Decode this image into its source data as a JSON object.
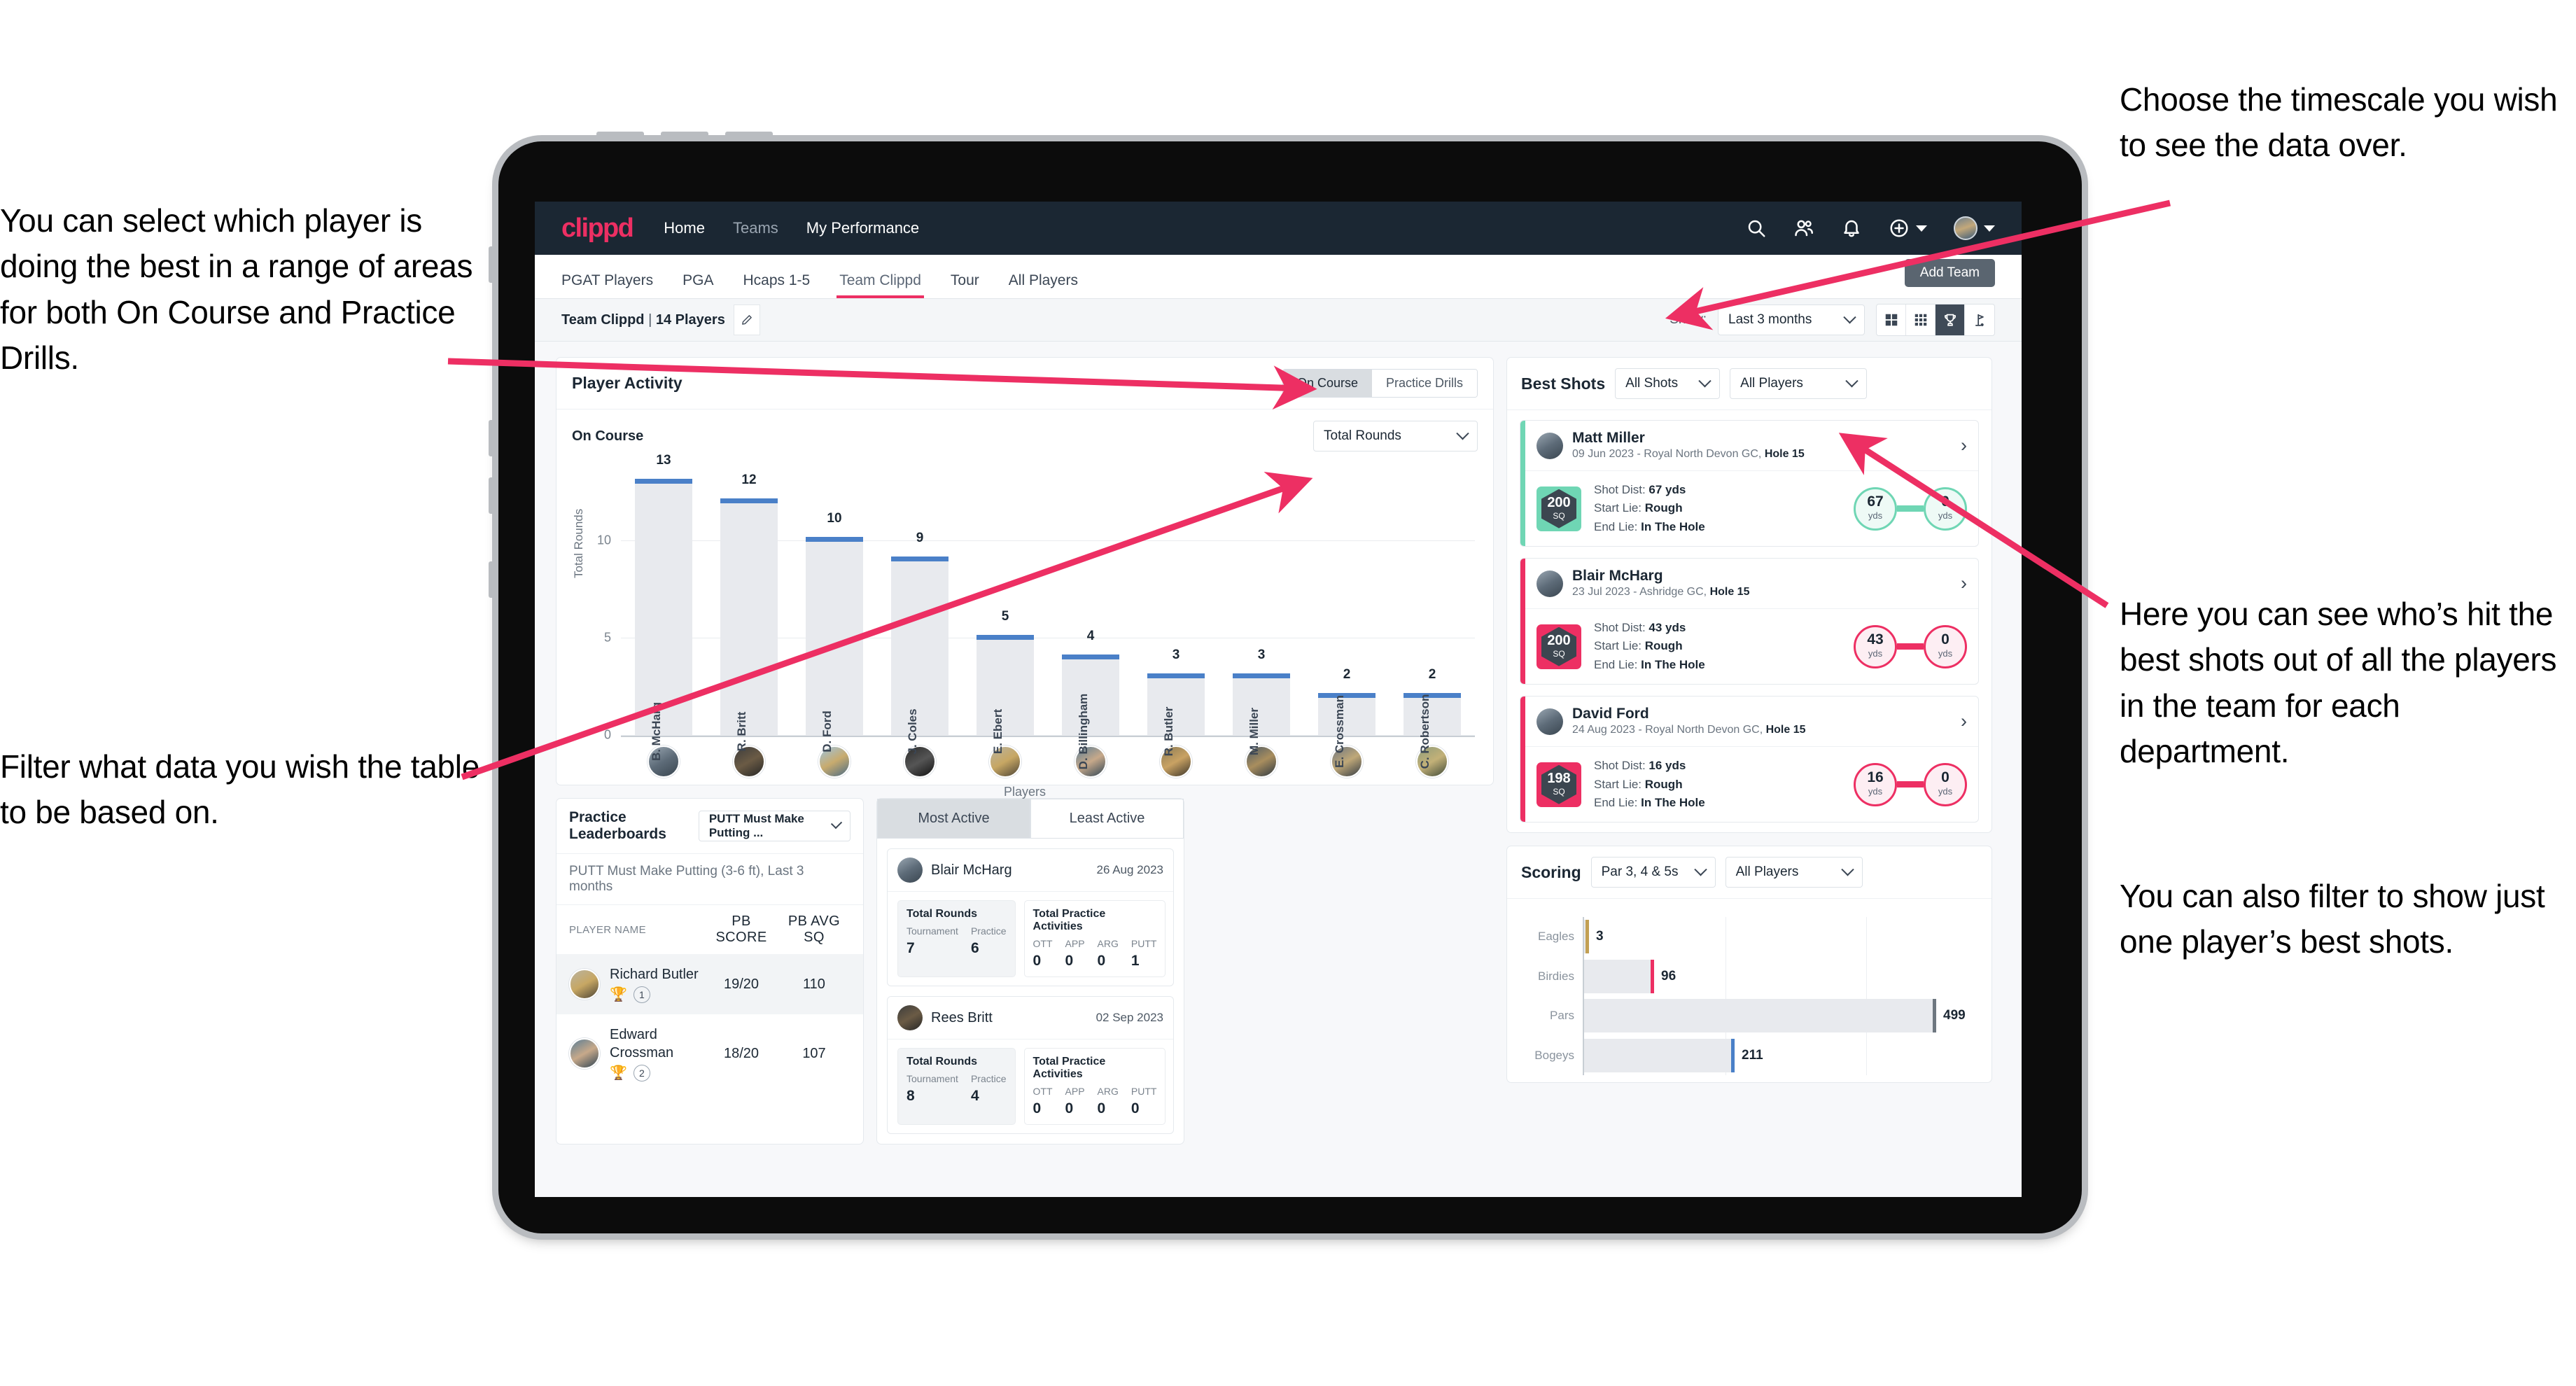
{
  "annotations": {
    "left_top": "You can select which player is doing the best in a range of areas for both On Course and Practice Drills.",
    "left_bottom": "Filter what data you wish the table to be based on.",
    "right_top": "Choose the timescale you wish to see the data over.",
    "right_middle": "Here you can see who’s hit the best shots out of all the players in the team for each department.",
    "right_bottom": "You can also filter to show just one player’s best shots."
  },
  "navbar": {
    "logo": "clippd",
    "links": [
      {
        "label": "Home",
        "active": true
      },
      {
        "label": "Teams",
        "active": false
      },
      {
        "label": "My Performance",
        "active": true
      }
    ],
    "icons": [
      "search-icon",
      "people-icon",
      "bell-icon",
      "plus-circle-icon",
      "avatar"
    ]
  },
  "tabs": {
    "items": [
      {
        "label": "PGAT Players",
        "active": false
      },
      {
        "label": "PGA",
        "active": false
      },
      {
        "label": "Hcaps 1-5",
        "active": false
      },
      {
        "label": "Team Clippd",
        "active": true
      },
      {
        "label": "Tour",
        "active": false
      },
      {
        "label": "All Players",
        "active": false
      }
    ],
    "tooltip": "Add Team"
  },
  "subheader": {
    "team_name": "Team Clippd",
    "team_separator": " | ",
    "team_players": "14 Players",
    "show_label": "Show:",
    "timescale_value": "Last 3 months",
    "view_buttons": [
      "grid-large-icon",
      "grid-small-icon",
      "trophy-icon",
      "flag-icon"
    ],
    "active_view": "trophy-icon"
  },
  "player_activity": {
    "title": "Player Activity",
    "segments": [
      {
        "label": "On Course",
        "active": true
      },
      {
        "label": "Practice Drills",
        "active": false
      }
    ],
    "sub_label": "On Course",
    "metric_value": "Total Rounds"
  },
  "chart_data": [
    {
      "type": "bar",
      "title": "Player Activity",
      "xlabel": "Players",
      "ylabel": "Total Rounds",
      "ylim": [
        0,
        14
      ],
      "yticks": [
        0,
        5,
        10
      ],
      "grid": true,
      "categories": [
        "B. McHarg",
        "R. Britt",
        "D. Ford",
        "J. Coles",
        "E. Ebert",
        "D. Billingham",
        "R. Butler",
        "M. Miller",
        "E. Crossman",
        "C. Robertson"
      ],
      "values": [
        13,
        12,
        10,
        9,
        5,
        4,
        3,
        3,
        2,
        2
      ],
      "bar_color": "#e8eaee",
      "cap_color": "#4a80c8"
    },
    {
      "type": "bar",
      "orientation": "horizontal",
      "title": "Scoring",
      "categories": [
        "Eagles",
        "Birdies",
        "Pars",
        "Bogeys"
      ],
      "values": [
        3,
        96,
        499,
        211
      ],
      "xlim": [
        0,
        560
      ],
      "grid": true,
      "tip_colors": [
        "#c2a053",
        "#ed2f63",
        "#6e7780",
        "#4a80c8"
      ]
    }
  ],
  "best_shots": {
    "title": "Best Shots",
    "filter_shots": "All Shots",
    "filter_players": "All Players",
    "shots": [
      {
        "player": "Matt Miller",
        "meta_prefix": "09 Jun 2023 - Royal North Devon GC, ",
        "hole": "Hole 15",
        "score": "200",
        "score_unit": "SQ",
        "accent": "#6fd6b4",
        "shot_dist_label": "Shot Dist: ",
        "shot_dist": "67 yds",
        "start_lie_label": "Start Lie: ",
        "start_lie": "Rough",
        "end_lie_label": "End Lie: ",
        "end_lie": "In The Hole",
        "from_value": "67",
        "from_unit": "yds",
        "to_value": "0",
        "to_unit": "yds"
      },
      {
        "player": "Blair McHarg",
        "meta_prefix": "23 Jul 2023 - Ashridge GC, ",
        "hole": "Hole 15",
        "score": "200",
        "score_unit": "SQ",
        "accent": "#ed2f63",
        "shot_dist_label": "Shot Dist: ",
        "shot_dist": "43 yds",
        "start_lie_label": "Start Lie: ",
        "start_lie": "Rough",
        "end_lie_label": "End Lie: ",
        "end_lie": "In The Hole",
        "from_value": "43",
        "from_unit": "yds",
        "to_value": "0",
        "to_unit": "yds"
      },
      {
        "player": "David Ford",
        "meta_prefix": "24 Aug 2023 - Royal North Devon GC, ",
        "hole": "Hole 15",
        "score": "198",
        "score_unit": "SQ",
        "accent": "#ed2f63",
        "shot_dist_label": "Shot Dist: ",
        "shot_dist": "16 yds",
        "start_lie_label": "Start Lie: ",
        "start_lie": "Rough",
        "end_lie_label": "End Lie: ",
        "end_lie": "In The Hole",
        "from_value": "16",
        "from_unit": "yds",
        "to_value": "0",
        "to_unit": "yds"
      }
    ]
  },
  "practice_leaderboards": {
    "title": "Practice Leaderboards",
    "drill_select": "PUTT Must Make Putting ...",
    "subtitle_bold": "PUTT Must Make Putting (3-6 ft),",
    "subtitle_light": " Last 3 months",
    "columns": [
      "PLAYER NAME",
      "PB SCORE",
      "PB AVG SQ"
    ],
    "rows": [
      {
        "name": "Richard Butler",
        "rank": "1",
        "trophy": "gold",
        "pb_score": "19/20",
        "pb_avg_sq": "110",
        "highlighted": true
      },
      {
        "name": "Edward Crossman",
        "rank": "2",
        "trophy": "silver",
        "pb_score": "18/20",
        "pb_avg_sq": "107",
        "highlighted": false
      }
    ]
  },
  "activity": {
    "tabs": [
      {
        "label": "Most Active",
        "active": true
      },
      {
        "label": "Least Active",
        "active": false
      }
    ],
    "cards": [
      {
        "name": "Blair McHarg",
        "date": "26 Aug 2023",
        "rounds_title": "Total Rounds",
        "rounds_keys": [
          "Tournament",
          "Practice"
        ],
        "rounds_values": [
          "7",
          "6"
        ],
        "practice_title": "Total Practice Activities",
        "practice_keys": [
          "OTT",
          "APP",
          "ARG",
          "PUTT"
        ],
        "practice_values": [
          "0",
          "0",
          "0",
          "1"
        ]
      },
      {
        "name": "Rees Britt",
        "date": "02 Sep 2023",
        "rounds_title": "Total Rounds",
        "rounds_keys": [
          "Tournament",
          "Practice"
        ],
        "rounds_values": [
          "8",
          "4"
        ],
        "practice_title": "Total Practice Activities",
        "practice_keys": [
          "OTT",
          "APP",
          "ARG",
          "PUTT"
        ],
        "practice_values": [
          "0",
          "0",
          "0",
          "0"
        ]
      }
    ]
  },
  "scoring": {
    "title": "Scoring",
    "filter_par": "Par 3, 4 & 5s",
    "filter_players": "All Players"
  },
  "colors": {
    "brand_pink": "#ed2f63",
    "navy": "#1b2733",
    "bar_blue": "#4a80c8",
    "teal": "#6fd6b4"
  }
}
